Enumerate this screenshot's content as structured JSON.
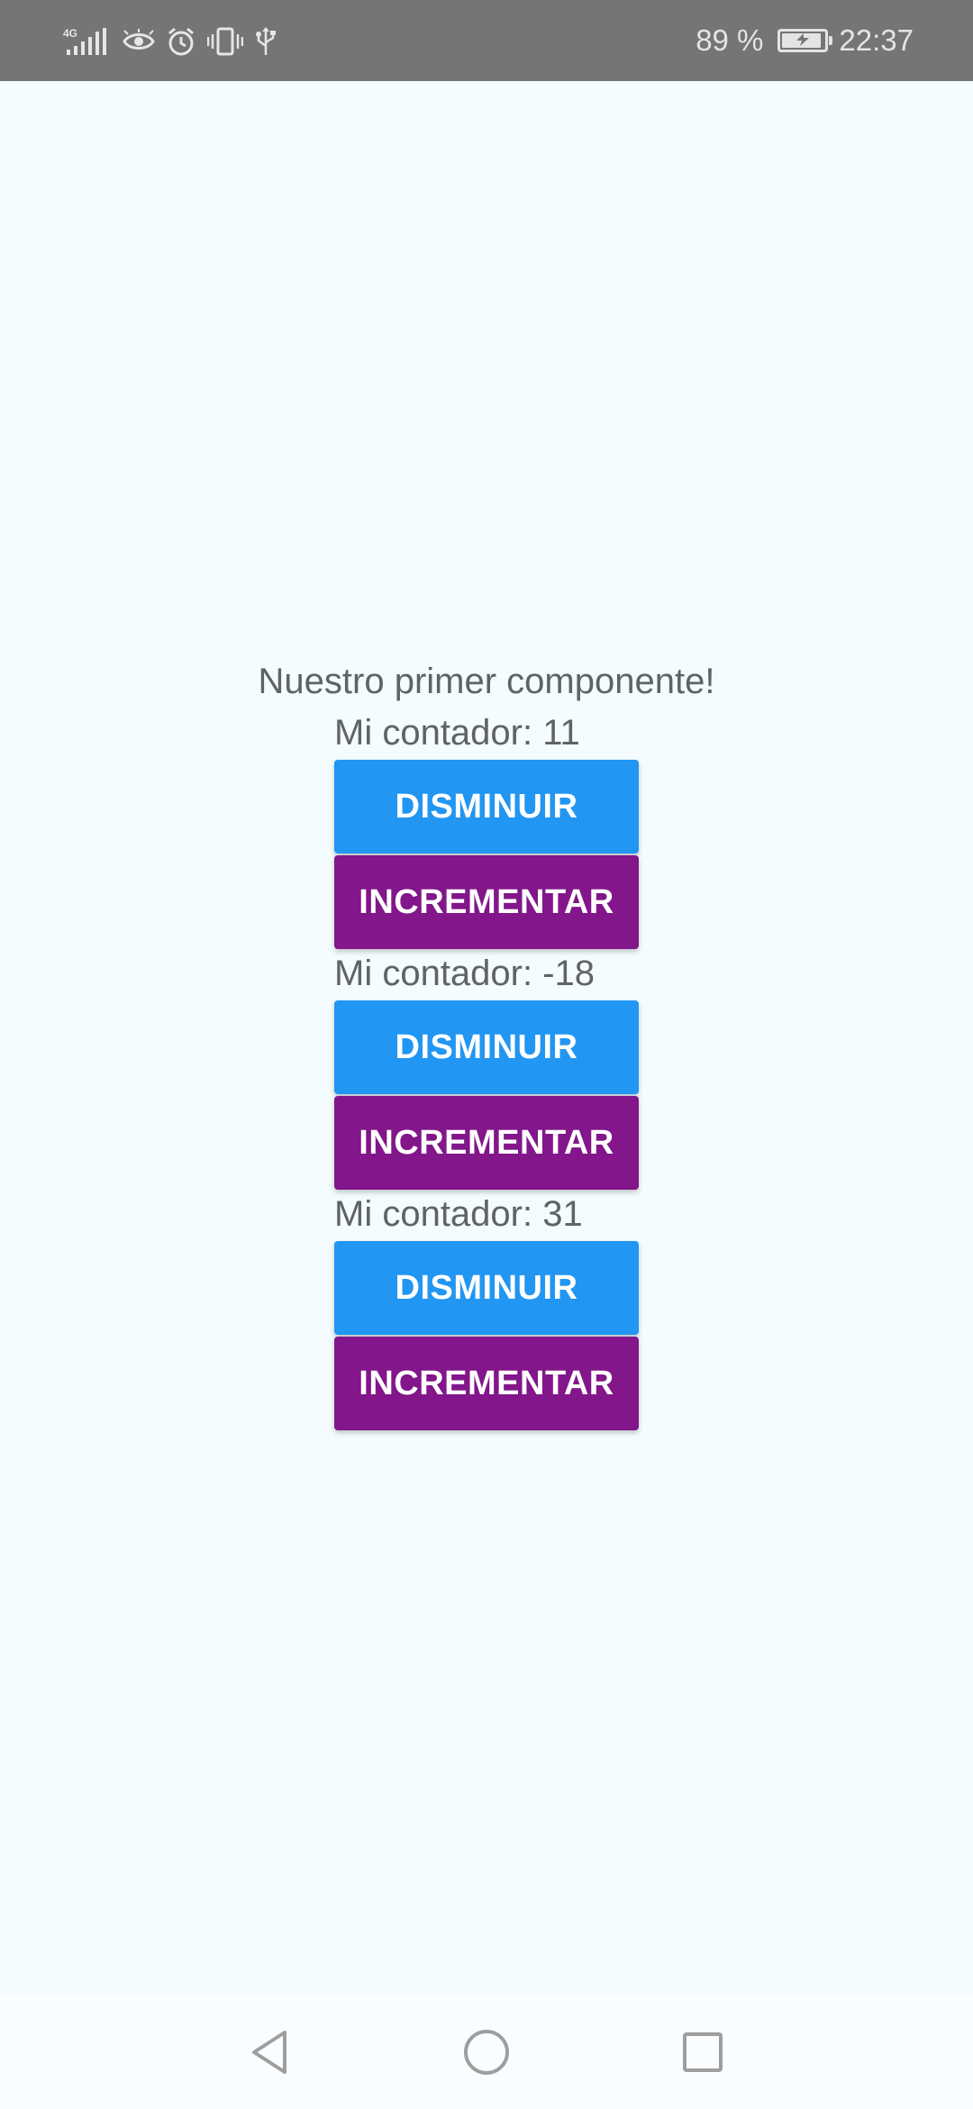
{
  "status_bar": {
    "network_label": "4G",
    "battery_percent": "89 %",
    "time": "22:37",
    "icons": [
      "signal-icon",
      "eye-icon",
      "alarm-icon",
      "vibrate-icon",
      "usb-icon",
      "battery-charging-icon"
    ]
  },
  "main": {
    "title": "Nuestro primer componente!",
    "counters": [
      {
        "label": "Mi contador: 11",
        "decrease_label": "DISMINUIR",
        "increase_label": "INCREMENTAR"
      },
      {
        "label": "Mi contador: -18",
        "decrease_label": "DISMINUIR",
        "increase_label": "INCREMENTAR"
      },
      {
        "label": "Mi contador: 31",
        "decrease_label": "DISMINUIR",
        "increase_label": "INCREMENTAR"
      }
    ]
  },
  "colors": {
    "background": "#f4fcff",
    "decrease_button": "#2196f3",
    "increase_button": "#82168a",
    "status_bar": "#757575",
    "text": "#5f6368"
  },
  "nav_bar": {
    "icons": [
      "back-icon",
      "home-icon",
      "recents-icon"
    ]
  }
}
